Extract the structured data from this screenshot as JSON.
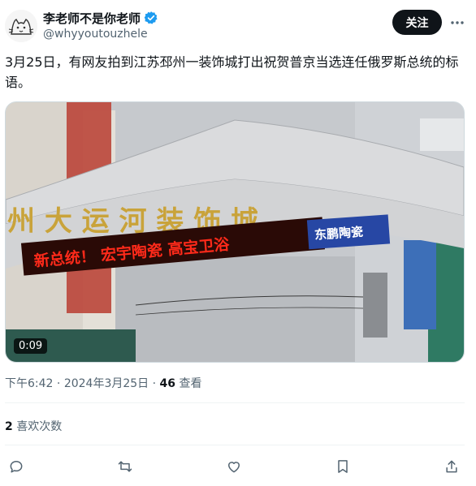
{
  "author": {
    "display_name": "李老师不是你老师",
    "handle": "@whyyoutouzhele",
    "verified_icon": "verified-badge-icon",
    "avatar_icon": "cat-sketch-avatar"
  },
  "header": {
    "follow_label": "关注",
    "more_icon": "more-horizontal-icon"
  },
  "tweet": {
    "text": "3月25日，有网友拍到江苏邳州一装饰城打出祝贺普京当选连任俄罗斯总统的标语。"
  },
  "media": {
    "type": "video",
    "duration": "0:09",
    "arch_sign_text": "州 大 运 河 装 饰 城",
    "led_text": "新总统！ 宏宇陶瓷 高宝卫浴",
    "blue_sign_text": "东鹏陶瓷",
    "colors": {
      "sky": "#c9ccd0",
      "arch": "#d8d9db",
      "gold_text": "#c9a33a",
      "led_red": "#ff2a1a",
      "led_bg": "#2a0a06"
    }
  },
  "meta": {
    "time": "下午6:42",
    "date": "2024年3月25日",
    "views_count": "46",
    "views_label": "查看"
  },
  "engagement": {
    "likes_count": "2",
    "likes_label": "喜欢次数"
  },
  "actions": [
    {
      "name": "reply",
      "icon": "reply-icon"
    },
    {
      "name": "retweet",
      "icon": "retweet-icon"
    },
    {
      "name": "like",
      "icon": "heart-icon"
    },
    {
      "name": "bookmark",
      "icon": "bookmark-icon"
    },
    {
      "name": "share",
      "icon": "share-icon"
    }
  ],
  "accent": "#1d9bf0"
}
